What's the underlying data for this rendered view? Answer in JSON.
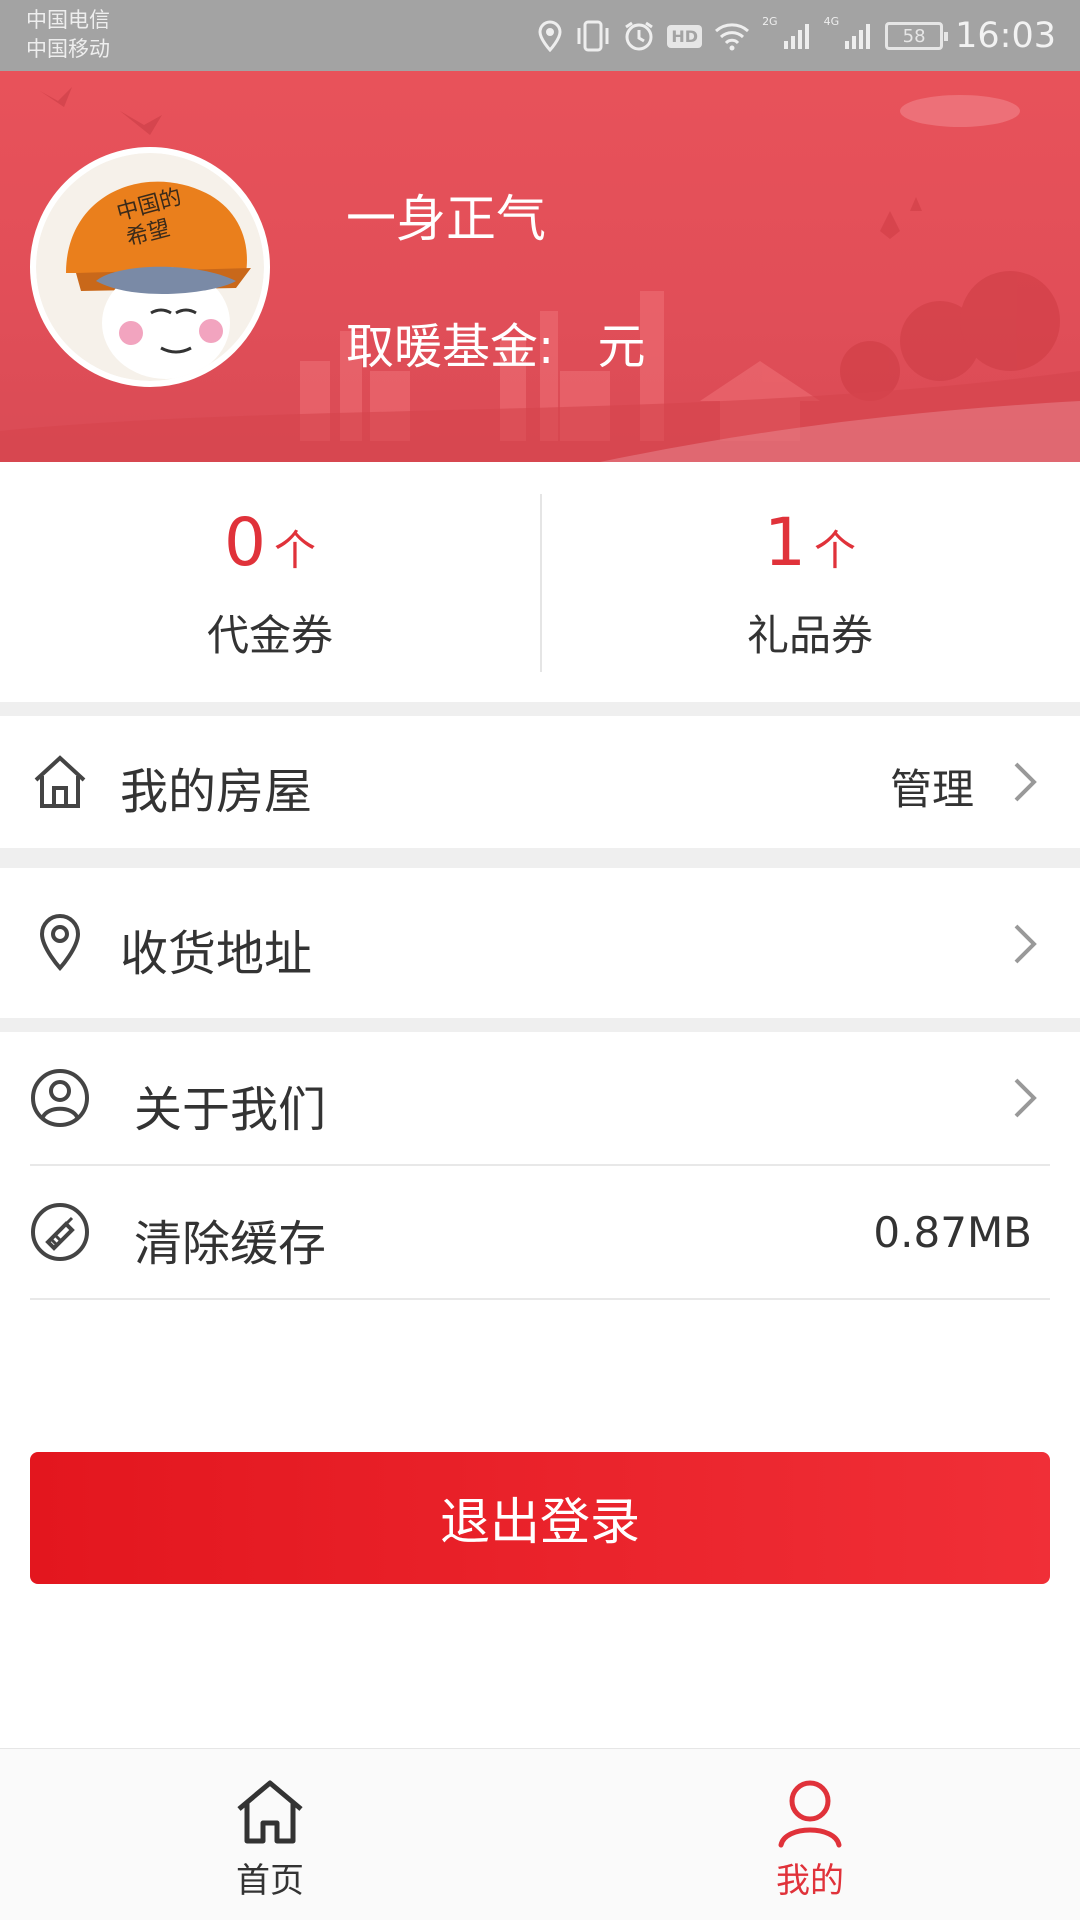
{
  "status_bar": {
    "carrier_1": "中国电信",
    "carrier_2": "中国移动",
    "hd": "HD",
    "net_2g": "2G",
    "net_4g": "4G",
    "battery": "58",
    "time": "16:03"
  },
  "profile": {
    "username": "一身正气",
    "fund_label": "取暖基金:",
    "fund_value": "",
    "fund_unit": "元",
    "accent_color": "#e14e58"
  },
  "coupons": [
    {
      "count": "0",
      "unit": "个",
      "label": "代金券"
    },
    {
      "count": "1",
      "unit": "个",
      "label": "礼品券"
    }
  ],
  "menu": {
    "house": {
      "icon": "house-icon",
      "label": "我的房屋",
      "action": "管理"
    },
    "address": {
      "icon": "location-pin-icon",
      "label": "收货地址"
    },
    "about": {
      "icon": "user-circle-icon",
      "label": "关于我们"
    },
    "cache": {
      "icon": "broom-icon",
      "label": "清除缓存",
      "value": "0.87MB"
    }
  },
  "logout_label": "退出登录",
  "tabs": [
    {
      "icon": "home-icon",
      "label": "首页",
      "active": false
    },
    {
      "icon": "person-icon",
      "label": "我的",
      "active": true,
      "color": "#e0323a"
    }
  ]
}
